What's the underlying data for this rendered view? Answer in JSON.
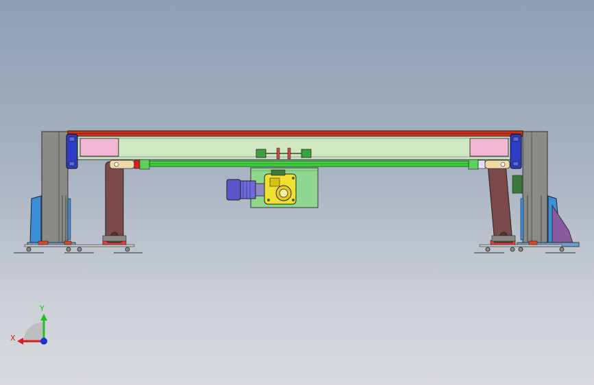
{
  "viewport": {
    "background_top": "#8f9fb4",
    "background_bottom": "#d8dadd"
  },
  "model": {
    "view": "front",
    "parts": [
      "left-column",
      "right-column",
      "top-rail",
      "inner-frame-panel",
      "left-bearing-block",
      "right-bearing-block",
      "drive-shaft",
      "left-swing-arm",
      "right-swing-arm",
      "gear-motor",
      "gearbox",
      "motor-mount-plate",
      "couplings",
      "left-base",
      "right-base"
    ],
    "colors": {
      "column": "#8a8a86",
      "rail": "#c8321f",
      "frame": "#cfe8c2",
      "shaft": "#3fd33f",
      "pink_block": "#f2b6d2",
      "arm": "#7a4a4a",
      "motor": "#5a55c8",
      "gearbox": "#f0e030",
      "mount_plate": "#8fd68f",
      "base_blue": "#3a8fd6"
    }
  },
  "triad": {
    "x_label": "X",
    "y_label": "Y",
    "x_color": "#d42020",
    "y_color": "#20c020",
    "z_color": "#2030d0"
  }
}
